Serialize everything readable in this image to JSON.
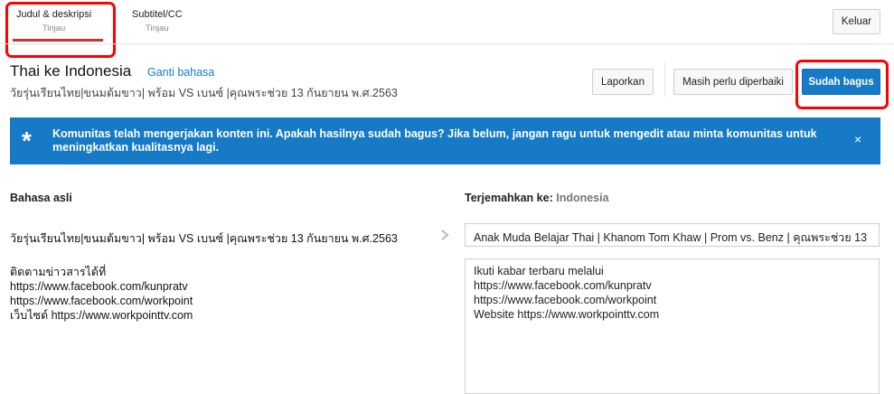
{
  "tabs": [
    {
      "label": "Judul & deskripsi",
      "status": "Tinjau"
    },
    {
      "label": "Subtitel/CC",
      "status": "Tinjau"
    }
  ],
  "exit_label": "Keluar",
  "header": {
    "title": "Thai ke Indonesia",
    "change_language": "Ganti bahasa",
    "video_title": "วัยรุ่นเรียนไทย|ขนมต้มขาว| พร้อม VS เบนซ์ |คุณพระช่วย 13 กันยายน พ.ศ.2563"
  },
  "actions": {
    "report": "Laporkan",
    "needs_work": "Masih perlu diperbaiki",
    "looks_good": "Sudah bagus"
  },
  "banner": {
    "message": "Komunitas telah mengerjakan konten ini. Apakah hasilnya sudah bagus? Jika belum, jangan ragu untuk mengedit atau minta komunitas untuk meningkatkan kualitasnya lagi.",
    "close": "×"
  },
  "original": {
    "label": "Bahasa asli",
    "title": "วัยรุ่นเรียนไทย|ขนมต้มขาว| พร้อม VS เบนซ์ |คุณพระช่วย 13 กันยายน พ.ศ.2563",
    "description": "ติดตามข่าวสารได้ที่\nhttps://www.facebook.com/kunpratv\nhttps://www.facebook.com/workpoint\nเว็บไซต์ https://www.workpointtv.com"
  },
  "translation": {
    "label": "Terjemahkan ke:",
    "language": "Indonesia",
    "title": "Anak Muda Belajar Thai | Khanom Tom Khaw | Prom vs. Benz | คุณพระช่วย 13",
    "description": "Ikuti kabar terbaru melalui\nhttps://www.facebook.com/kunpratv\nhttps://www.facebook.com/workpoint\nWebsite https://www.workpointtv.com"
  },
  "colors": {
    "accent": "#167ac6",
    "highlight": "#ff0000",
    "tab_underline": "#cc3333"
  }
}
